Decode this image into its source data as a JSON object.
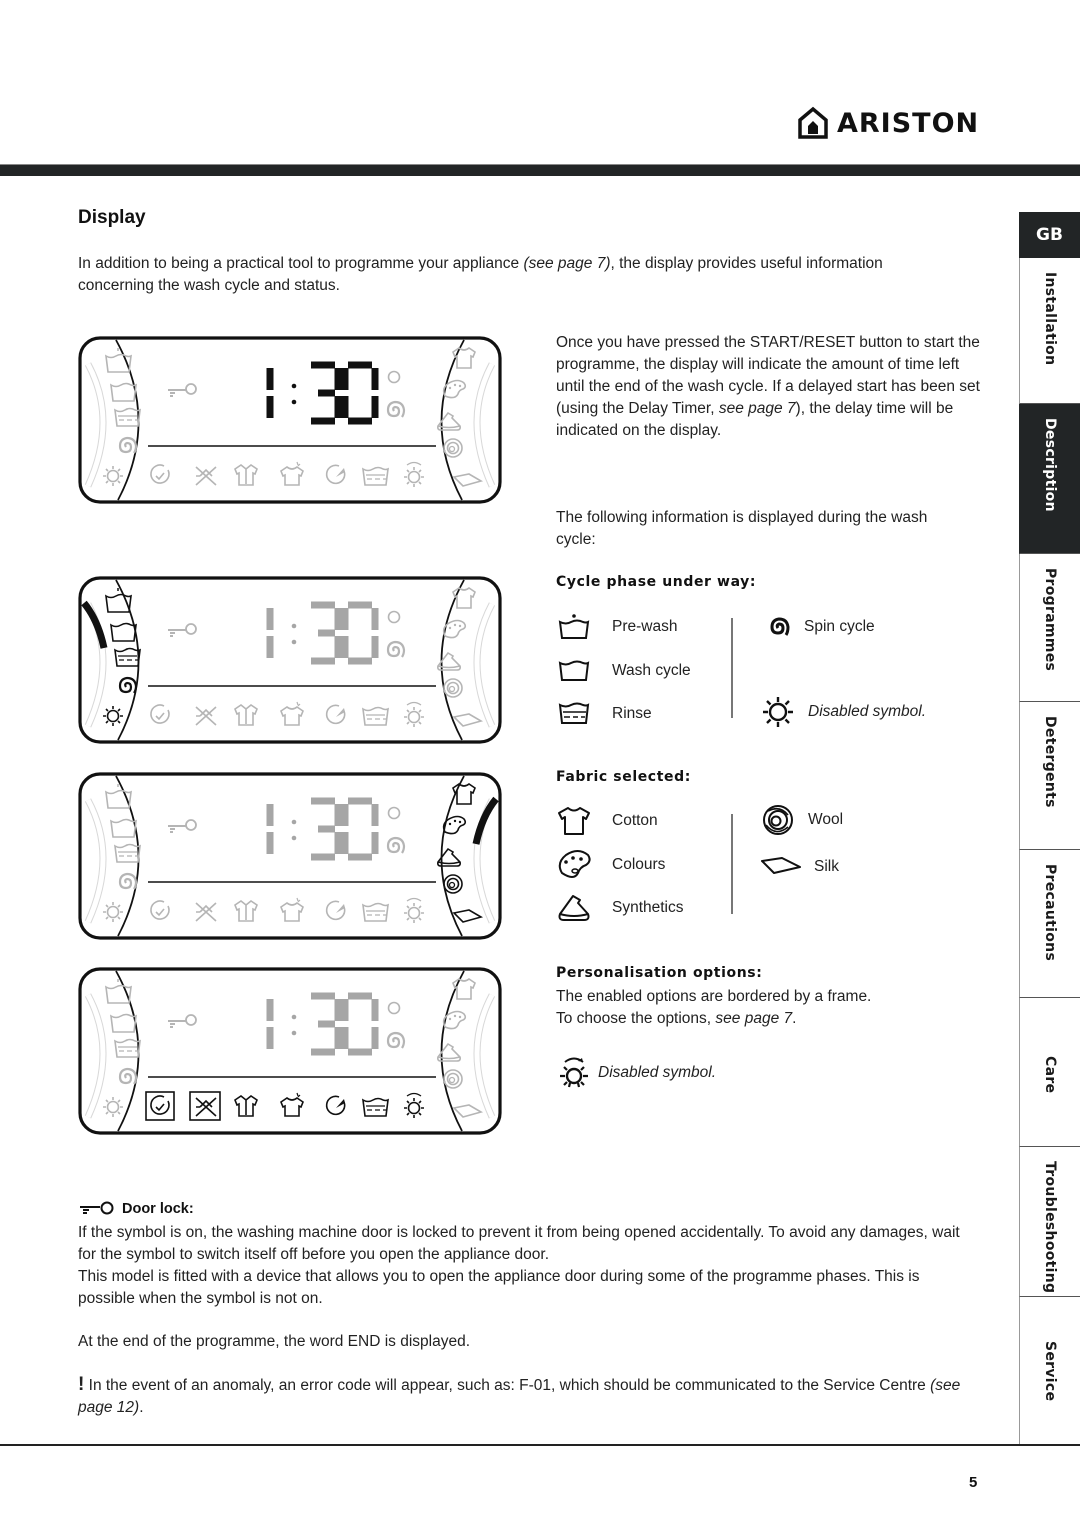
{
  "brand": {
    "name": "ARISTON"
  },
  "section": {
    "title": "Display"
  },
  "intro": {
    "before": "In addition to being a practical tool to programme your appliance ",
    "ref": "(see page 7)",
    "after": ", the display provides useful information concerning the wash cycle and status."
  },
  "displays": [
    {
      "time": "1:30",
      "state": "time-active",
      "highlight": "time"
    },
    {
      "time": "1:30",
      "state": "phase-progress",
      "highlight": "cycle-phase-bar"
    },
    {
      "time": "1:30",
      "state": "fabric-selected",
      "highlight": "fabric-bar"
    },
    {
      "time": "1:30",
      "state": "options-framed",
      "highlight": "option-frames",
      "framed_options": [
        "delay-timer",
        "easy-iron"
      ]
    }
  ],
  "right_column": {
    "para1_before": "Once you have pressed the START/RESET button to start the programme, the display will indicate the amount of time left until the end of the wash cycle. If a delayed start has been set (using the Delay Timer, ",
    "para1_ref": "see page 7",
    "para1_after": "), the delay time will be indicated on the display.",
    "para2": "The following information is displayed during the wash cycle:"
  },
  "cycle_phase": {
    "heading": "Cycle phase under way:",
    "items": [
      {
        "icon": "prewash-tub-icon",
        "label": "Pre-wash"
      },
      {
        "icon": "wash-tub-icon",
        "label": "Wash cycle"
      },
      {
        "icon": "rinse-tub-icon",
        "label": "Rinse"
      },
      {
        "icon": "spin-spiral-icon",
        "label": "Spin cycle"
      },
      {
        "icon": "sun-disabled-icon",
        "label": "Disabled symbol."
      }
    ]
  },
  "fabric": {
    "heading": "Fabric selected:",
    "items": [
      {
        "icon": "cotton-shirt-icon",
        "label": "Cotton"
      },
      {
        "icon": "colours-palette-icon",
        "label": "Colours"
      },
      {
        "icon": "synthetics-icon",
        "label": "Synthetics"
      },
      {
        "icon": "wool-icon",
        "label": "Wool"
      },
      {
        "icon": "silk-icon",
        "label": "Silk"
      }
    ]
  },
  "personalisation": {
    "heading": "Personalisation options:",
    "line1": "The enabled options are bordered by a frame.",
    "line2_before": "To choose the options, ",
    "line2_ref": "see page 7",
    "line2_after": ".",
    "disabled_label": "Disabled symbol."
  },
  "door_lock": {
    "heading": "Door lock:",
    "p1": "If the symbol is on, the washing machine door is locked to prevent it from being opened accidentally. To avoid any damages, wait for the symbol to switch itself off before you open the appliance door.",
    "p2": "This model is fitted with a device that allows you to open the appliance door during some of the programme phases. This is possible when the symbol is not on."
  },
  "end_note": "At the end of the programme, the word END is displayed.",
  "warning": {
    "mark": "!",
    "before": " In the event of an anomaly, an error code will appear, such as: F-01, which should be communicated to the Service Centre ",
    "ref": "(see page 12)",
    "after": "."
  },
  "side_tabs": {
    "language": "GB",
    "items": [
      {
        "label": "Installation",
        "active": false
      },
      {
        "label": "Description",
        "active": true
      },
      {
        "label": "Programmes",
        "active": false
      },
      {
        "label": "Detergents",
        "active": false
      },
      {
        "label": "Precautions",
        "active": false
      },
      {
        "label": "Care",
        "active": false
      },
      {
        "label": "Troubleshooting",
        "active": false
      },
      {
        "label": "Service",
        "active": false
      }
    ]
  },
  "page_number": "5"
}
